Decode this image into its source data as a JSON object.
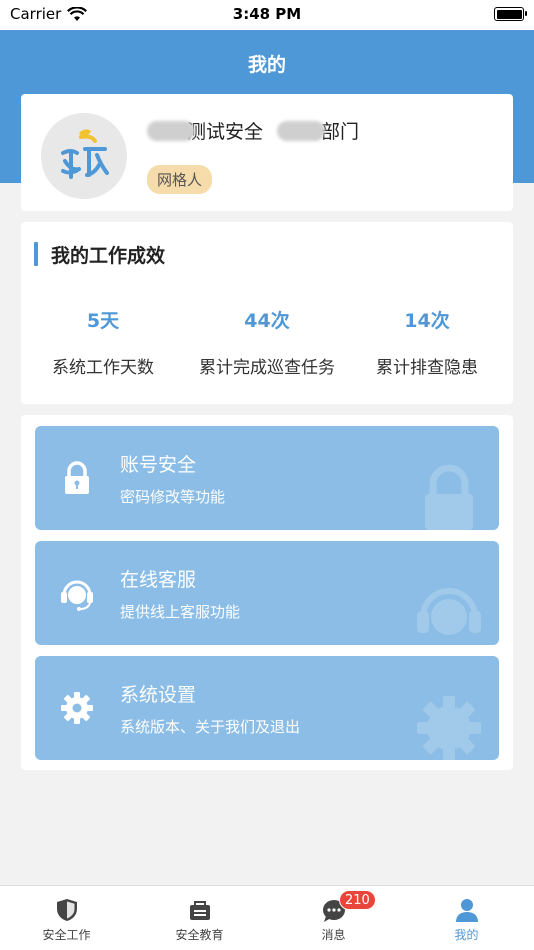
{
  "status_bar": {
    "carrier": "Carrier",
    "time": "3:48 PM"
  },
  "header": {
    "title": "我的"
  },
  "profile": {
    "name_visible": "测试安全",
    "dept_visible": "部门",
    "role": "网格人"
  },
  "stats": {
    "title": "我的工作成效",
    "items": [
      {
        "value": "5天",
        "label": "系统工作天数"
      },
      {
        "value": "44次",
        "label": "累计完成巡查任务"
      },
      {
        "value": "14次",
        "label": "累计排查隐患"
      }
    ]
  },
  "menu": {
    "items": [
      {
        "title": "账号安全",
        "subtitle": "密码修改等功能",
        "icon": "lock-icon"
      },
      {
        "title": "在线客服",
        "subtitle": "提供线上客服功能",
        "icon": "headset-icon"
      },
      {
        "title": "系统设置",
        "subtitle": "系统版本、关于我们及退出",
        "icon": "gear-icon"
      }
    ]
  },
  "tabs": [
    {
      "label": "安全工作",
      "icon": "shield-icon"
    },
    {
      "label": "安全教育",
      "icon": "education-icon"
    },
    {
      "label": "消息",
      "icon": "chat-icon",
      "badge": "210"
    },
    {
      "label": "我的",
      "icon": "user-icon",
      "active": true
    }
  ],
  "colors": {
    "accent": "#4f98d7",
    "menu_bg": "#8bbde6",
    "badge": "#e8463b",
    "role_bg": "#f6dcaa"
  }
}
